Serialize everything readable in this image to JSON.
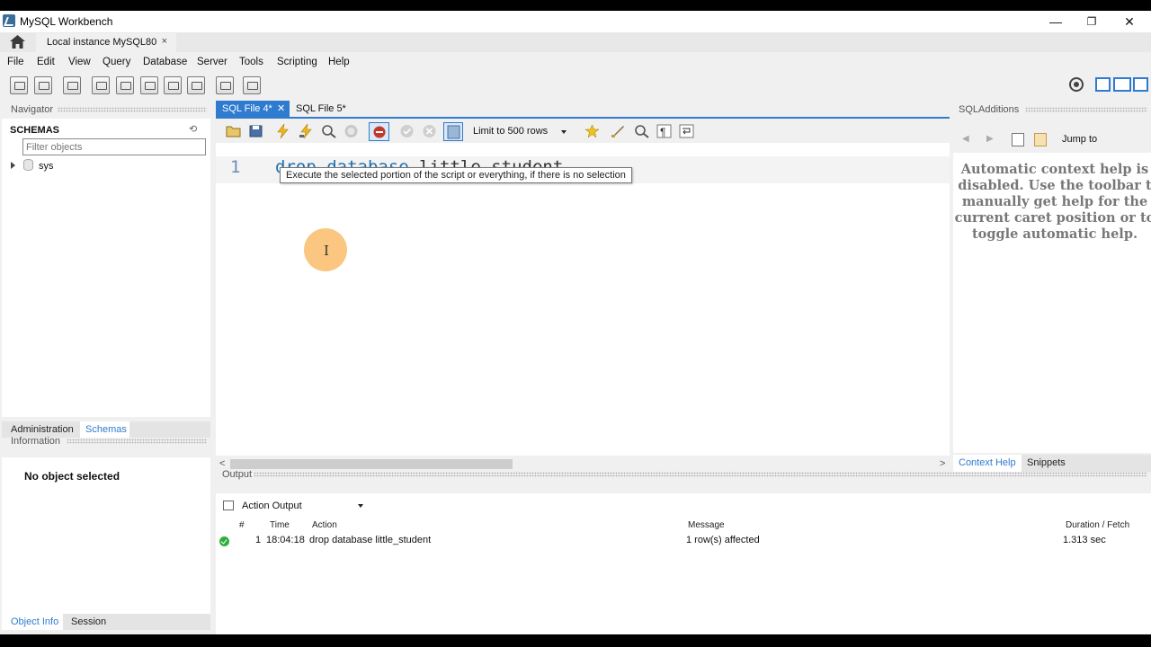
{
  "window": {
    "title": "MySQL Workbench",
    "minimize": "—",
    "restore": "❐",
    "close": "✕"
  },
  "connection_tab": {
    "label": "Local instance MySQL80",
    "close": "×"
  },
  "menu": [
    "File",
    "Edit",
    "View",
    "Query",
    "Database",
    "Server",
    "Tools",
    "Scripting",
    "Help"
  ],
  "navigator": {
    "title": "Navigator",
    "schemas_label": "SCHEMAS",
    "filter_placeholder": "Filter objects",
    "schemas": [
      "sys"
    ],
    "tabs": [
      "Administration",
      "Schemas"
    ],
    "active_tab": "Schemas"
  },
  "information": {
    "title": "Information",
    "message": "No object selected",
    "tabs": [
      "Object Info",
      "Session"
    ],
    "active_tab": "Object Info"
  },
  "editor": {
    "tabs": [
      {
        "label": "SQL File 4*",
        "active": true,
        "close": "✕"
      },
      {
        "label": "SQL File 5*",
        "active": false
      }
    ],
    "limit": "Limit to 500 rows",
    "line_number": "1",
    "code_keyword": "drop database",
    "code_rest": " little_student",
    "tooltip": "Execute the selected portion of the script or everything, if there is no selection",
    "cursor_icon": "ibeam-cursor-icon"
  },
  "output": {
    "title": "Output",
    "selector": "Action Output",
    "columns": [
      "#",
      "Time",
      "Action",
      "Message",
      "Duration / Fetch"
    ],
    "rows": [
      {
        "status": "success",
        "num": "1",
        "time": "18:04:18",
        "action": "drop database little_student",
        "message": "1 row(s) affected",
        "duration": "1.313 sec"
      }
    ]
  },
  "sql_additions": {
    "title": "SQLAdditions",
    "jump_to": "Jump to",
    "help_lines": [
      "Automatic context help is",
      "disabled. Use the toolbar t",
      "manually get help for the",
      "current caret position or to",
      "toggle automatic help."
    ],
    "tabs": [
      "Context Help",
      "Snippets"
    ],
    "active_tab": "Context Help"
  },
  "colors": {
    "accent": "#2e7bd0",
    "keyword": "#1a6fb3",
    "success": "#2fae3a",
    "cursor_highlight": "#fab864"
  }
}
